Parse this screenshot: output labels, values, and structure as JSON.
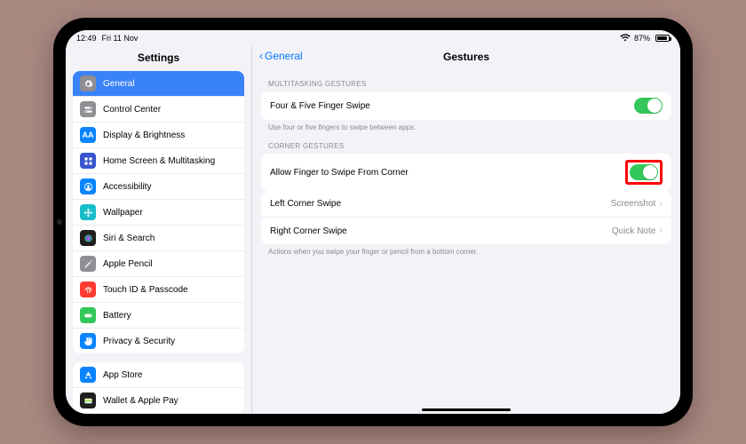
{
  "status": {
    "time": "12:49",
    "date": "Fri 11 Nov",
    "battery_pct": "87%"
  },
  "sidebar": {
    "title": "Settings",
    "groups": [
      [
        {
          "id": "general",
          "label": "General",
          "selected": true,
          "icon": "gear",
          "bg": "#8e8e93"
        },
        {
          "id": "control-center",
          "label": "Control Center",
          "icon": "switches",
          "bg": "#8e8e93"
        },
        {
          "id": "display",
          "label": "Display & Brightness",
          "icon": "AA",
          "bg": "#0a84ff"
        },
        {
          "id": "home",
          "label": "Home Screen & Multitasking",
          "icon": "grid",
          "bg": "#3755cf"
        },
        {
          "id": "accessibility",
          "label": "Accessibility",
          "icon": "person",
          "bg": "#0a84ff"
        },
        {
          "id": "wallpaper",
          "label": "Wallpaper",
          "icon": "flower",
          "bg": "#18bdc9"
        },
        {
          "id": "siri",
          "label": "Siri & Search",
          "icon": "siri",
          "bg": "#1f1f1f"
        },
        {
          "id": "pencil",
          "label": "Apple Pencil",
          "icon": "pencil",
          "bg": "#8e8e93"
        },
        {
          "id": "touchid",
          "label": "Touch ID & Passcode",
          "icon": "finger",
          "bg": "#ff3b30"
        },
        {
          "id": "battery",
          "label": "Battery",
          "icon": "batt",
          "bg": "#34c759"
        },
        {
          "id": "privacy",
          "label": "Privacy & Security",
          "icon": "hand",
          "bg": "#0a84ff"
        }
      ],
      [
        {
          "id": "appstore",
          "label": "App Store",
          "icon": "appstore",
          "bg": "#0a84ff"
        },
        {
          "id": "wallet",
          "label": "Wallet & Apple Pay",
          "icon": "wallet",
          "bg": "#1f1f1f"
        }
      ]
    ]
  },
  "detail": {
    "back_label": "General",
    "title": "Gestures",
    "sections": [
      {
        "header": "MULTITASKING GESTURES",
        "rows": [
          {
            "id": "four-five-swipe",
            "label": "Four & Five Finger Swipe",
            "type": "toggle",
            "on": true
          }
        ],
        "footer": "Use four or five fingers to swipe between apps."
      },
      {
        "header": "CORNER GESTURES",
        "rows": [
          {
            "id": "allow-corner",
            "label": "Allow Finger to Swipe From Corner",
            "type": "toggle",
            "on": true,
            "highlight": true
          }
        ]
      },
      {
        "rows": [
          {
            "id": "left-corner",
            "label": "Left Corner Swipe",
            "type": "link",
            "value": "Screenshot"
          },
          {
            "id": "right-corner",
            "label": "Right Corner Swipe",
            "type": "link",
            "value": "Quick Note"
          }
        ],
        "footer": "Actions when you swipe your finger or pencil from a bottom corner."
      }
    ]
  },
  "annotation": {
    "arrow_color": "#ff0000"
  }
}
